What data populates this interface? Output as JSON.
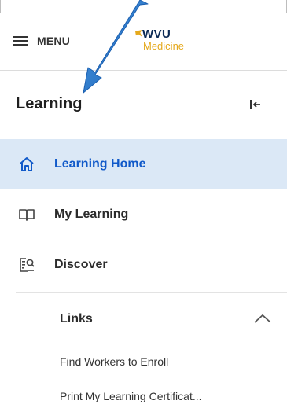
{
  "header": {
    "menu_label": "MENU",
    "logo_line1": "WVU",
    "logo_line2": "Medicine"
  },
  "sidebar": {
    "title": "Learning",
    "items": [
      {
        "label": "Learning Home",
        "icon": "home-icon",
        "active": true
      },
      {
        "label": "My Learning",
        "icon": "book-icon",
        "active": false
      },
      {
        "label": "Discover",
        "icon": "discover-icon",
        "active": false
      }
    ],
    "links_section": {
      "label": "Links",
      "expanded": true,
      "items": [
        {
          "label": "Find Workers to Enroll"
        },
        {
          "label": "Print My Learning Certificat..."
        }
      ]
    }
  },
  "colors": {
    "active_background": "#dbe8f6",
    "active_text": "#1059c9",
    "annotation_arrow": "#1f73c9",
    "logo_navy": "#0b2a55",
    "logo_gold": "#e5a91d"
  }
}
